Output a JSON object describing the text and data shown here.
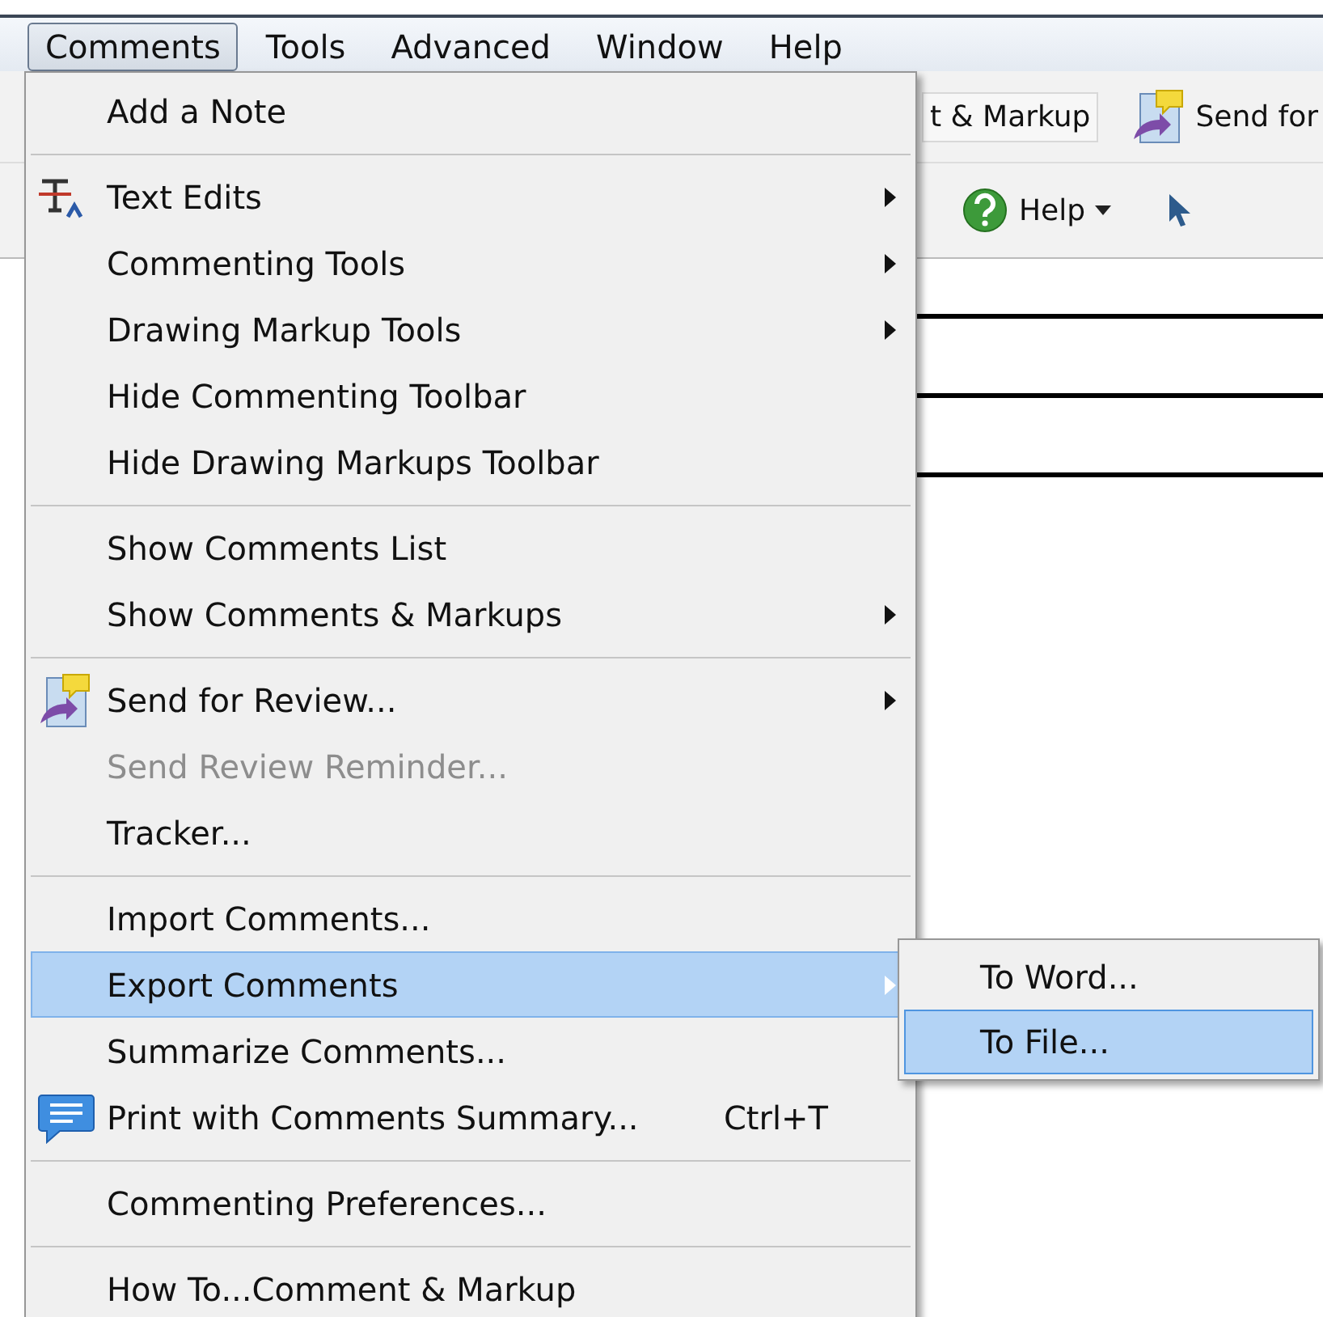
{
  "menubar": [
    {
      "label": "Comments",
      "selected": true
    },
    {
      "label": "Tools",
      "selected": false
    },
    {
      "label": "Advanced",
      "selected": false
    },
    {
      "label": "Window",
      "selected": false
    },
    {
      "label": "Help",
      "selected": false
    }
  ],
  "toolbar": {
    "markup_button": "t & Markup",
    "send_button": "Send for",
    "help_button": "Help"
  },
  "menu": [
    {
      "kind": "item",
      "label": "Add a Note",
      "submenu": false,
      "disabled": false,
      "selected": false
    },
    {
      "kind": "separator"
    },
    {
      "kind": "item",
      "label": "Text Edits",
      "submenu": true,
      "disabled": false,
      "selected": false
    },
    {
      "kind": "item",
      "label": "Commenting Tools",
      "submenu": true,
      "disabled": false,
      "selected": false
    },
    {
      "kind": "item",
      "label": "Drawing Markup Tools",
      "submenu": true,
      "disabled": false,
      "selected": false
    },
    {
      "kind": "item",
      "label": "Hide Commenting Toolbar",
      "submenu": false,
      "disabled": false,
      "selected": false
    },
    {
      "kind": "item",
      "label": "Hide Drawing Markups Toolbar",
      "submenu": false,
      "disabled": false,
      "selected": false
    },
    {
      "kind": "separator"
    },
    {
      "kind": "item",
      "label": "Show Comments List",
      "submenu": false,
      "disabled": false,
      "selected": false
    },
    {
      "kind": "item",
      "label": "Show Comments & Markups",
      "submenu": true,
      "disabled": false,
      "selected": false
    },
    {
      "kind": "separator"
    },
    {
      "kind": "item",
      "label": "Send for Review...",
      "submenu": true,
      "disabled": false,
      "selected": false
    },
    {
      "kind": "item",
      "label": "Send Review Reminder...",
      "submenu": false,
      "disabled": true,
      "selected": false
    },
    {
      "kind": "item",
      "label": "Tracker...",
      "submenu": false,
      "disabled": false,
      "selected": false
    },
    {
      "kind": "separator"
    },
    {
      "kind": "item",
      "label": "Import Comments...",
      "submenu": false,
      "disabled": false,
      "selected": false
    },
    {
      "kind": "item",
      "label": "Export Comments",
      "submenu": true,
      "disabled": false,
      "selected": true
    },
    {
      "kind": "item",
      "label": "Summarize Comments...",
      "submenu": false,
      "disabled": false,
      "selected": false
    },
    {
      "kind": "item",
      "label": "Print with Comments Summary...",
      "shortcut": "Ctrl+T",
      "submenu": false,
      "disabled": false,
      "selected": false
    },
    {
      "kind": "separator"
    },
    {
      "kind": "item",
      "label": "Commenting Preferences...",
      "submenu": false,
      "disabled": false,
      "selected": false
    },
    {
      "kind": "separator"
    },
    {
      "kind": "item",
      "label": "How To...Comment & Markup",
      "submenu": false,
      "disabled": false,
      "selected": false
    }
  ],
  "submenu": [
    {
      "label": "To Word...",
      "selected": false
    },
    {
      "label": "To File...",
      "selected": true
    }
  ]
}
